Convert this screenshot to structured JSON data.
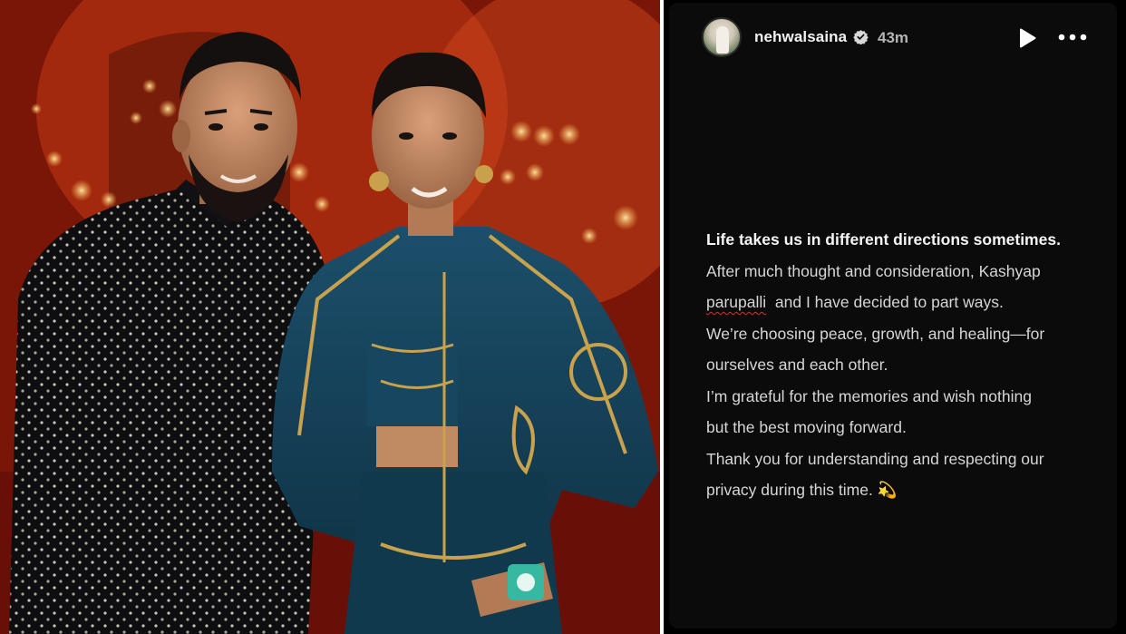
{
  "story": {
    "username": "nehwalsaina",
    "time": "43m",
    "icons": {
      "avatar": "profile-avatar",
      "verified": "verified-badge-icon",
      "play": "play-icon",
      "more": "more-options-icon"
    },
    "message": {
      "lead": "Life takes us in different directions sometimes.",
      "line_2": "After much thought and consideration, Kashyap",
      "line_3_name": "parupalli",
      "line_3_rest": "  and I have decided to part ways.",
      "line_4": "We’re choosing peace, growth, and healing—for",
      "line_5": "ourselves and each other.",
      "line_6": "I’m grateful for the memories and wish nothing",
      "line_7": "but the best moving forward.",
      "line_8": "Thank you for understanding and respecting our",
      "line_9": "privacy during this time.",
      "emoji": "💫"
    }
  },
  "colors": {
    "story_background": "#0b0b0b",
    "text_primary": "#f4f4f4",
    "text_secondary": "#d6d6d6",
    "spellcheck_underline": "#d23030",
    "photo_background": "#b3260f"
  }
}
